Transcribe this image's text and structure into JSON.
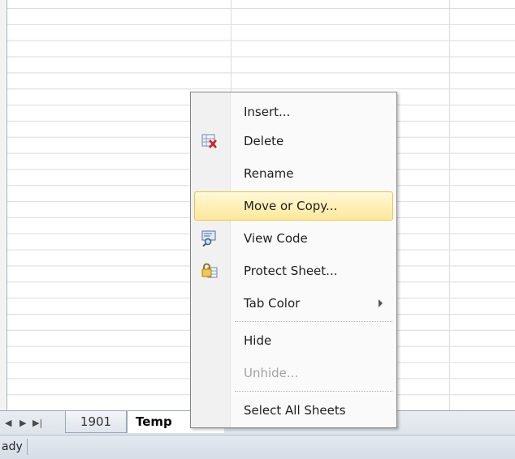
{
  "menu": {
    "items": [
      {
        "label": "Insert...",
        "icon": "none"
      },
      {
        "label": "Delete",
        "icon": "delete-sheet-icon"
      },
      {
        "label": "Rename",
        "icon": "none"
      },
      {
        "label": "Move or Copy...",
        "icon": "none",
        "highlighted": true
      },
      {
        "label": "View Code",
        "icon": "view-code-icon"
      },
      {
        "label": "Protect Sheet...",
        "icon": "protect-sheet-icon"
      },
      {
        "label": "Tab Color",
        "icon": "none",
        "submenu": true
      },
      {
        "label": "Hide",
        "icon": "none"
      },
      {
        "label": "Unhide...",
        "icon": "none",
        "disabled": true
      },
      {
        "label": "Select All Sheets",
        "icon": "none"
      }
    ]
  },
  "tabs": {
    "sheet1": "1901",
    "sheet2": "Temp"
  },
  "status": {
    "text": "ady"
  },
  "colors": {
    "highlight": "#fde89a",
    "highlight_border": "#e8c35a",
    "grid_line": "#dadcdd"
  }
}
